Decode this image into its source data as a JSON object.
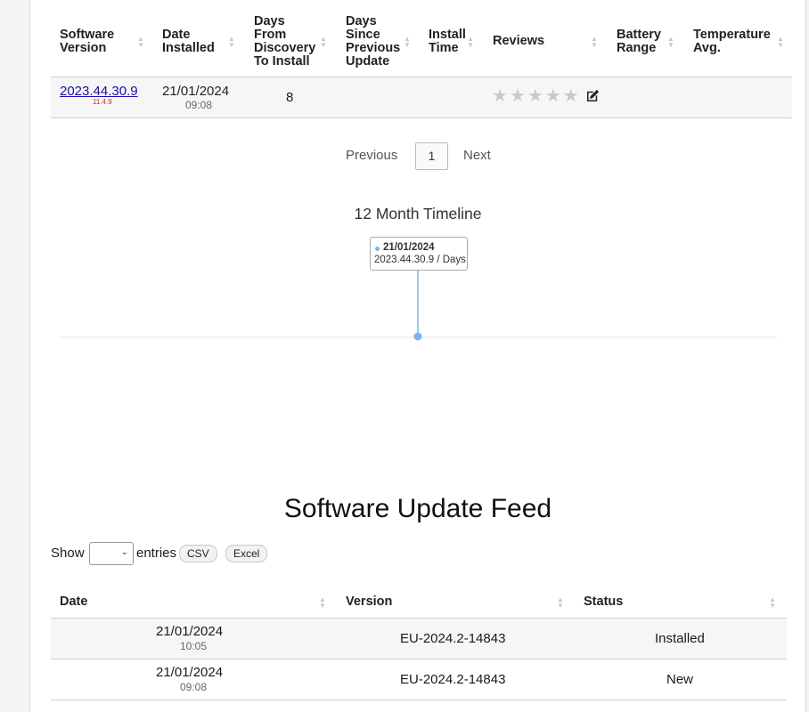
{
  "history_table": {
    "columns": [
      {
        "label": "Software Version",
        "lines": [
          "Software",
          "Version"
        ]
      },
      {
        "label": "Date Installed",
        "lines": [
          "Date",
          "Installed"
        ]
      },
      {
        "label": "Days From Discovery To Install",
        "lines": [
          "Days",
          "From",
          "Discovery",
          "To Install"
        ]
      },
      {
        "label": "Days Since Previous Update",
        "lines": [
          "Days",
          "Since",
          "Previous",
          "Update"
        ]
      },
      {
        "label": "Install Time",
        "lines": [
          "Install",
          "Time"
        ]
      },
      {
        "label": "Reviews",
        "lines": [
          "Reviews"
        ]
      },
      {
        "label": "Battery Range",
        "lines": [
          "Battery",
          "Range"
        ]
      },
      {
        "label": "Temperature Avg.",
        "lines": [
          "Temperature",
          "Avg."
        ]
      }
    ],
    "rows": [
      {
        "version": "2023.44.30.9",
        "sub_version": "11.4.9",
        "date": "21/01/2024",
        "time": "09:08",
        "days_from_discovery": "8",
        "days_since_previous": "",
        "install_time": "",
        "review_stars": 0,
        "review_max": 5,
        "battery_range": "",
        "temperature_avg": ""
      }
    ]
  },
  "pagination": {
    "previous": "Previous",
    "current": "1",
    "next": "Next"
  },
  "timeline": {
    "title": "12 Month Timeline",
    "tooltip_date": "21/01/2024",
    "tooltip_text": "2023.44.30.9 / Days",
    "point_color": "#7cb5ec"
  },
  "feed": {
    "title": "Software Update Feed",
    "show_label": "Show",
    "entries_label": "entries",
    "entries_value": "",
    "csv_label": "CSV",
    "excel_label": "Excel",
    "columns": [
      "Date",
      "Version",
      "Status"
    ],
    "rows": [
      {
        "date": "21/01/2024",
        "time": "10:05",
        "version": "EU-2024.2-14843",
        "status": "Installed"
      },
      {
        "date": "21/01/2024",
        "time": "09:08",
        "version": "EU-2024.2-14843",
        "status": "New"
      }
    ]
  },
  "colors": {
    "link": "#1a0dab",
    "sub_version": "#c0392b",
    "star_empty": "#c9c9c9",
    "row_alt": "#f6f6f6"
  },
  "icons": {
    "review_edit": "edit-icon",
    "sort": "sort-icon",
    "select_chevron": "chevron-down-icon"
  }
}
